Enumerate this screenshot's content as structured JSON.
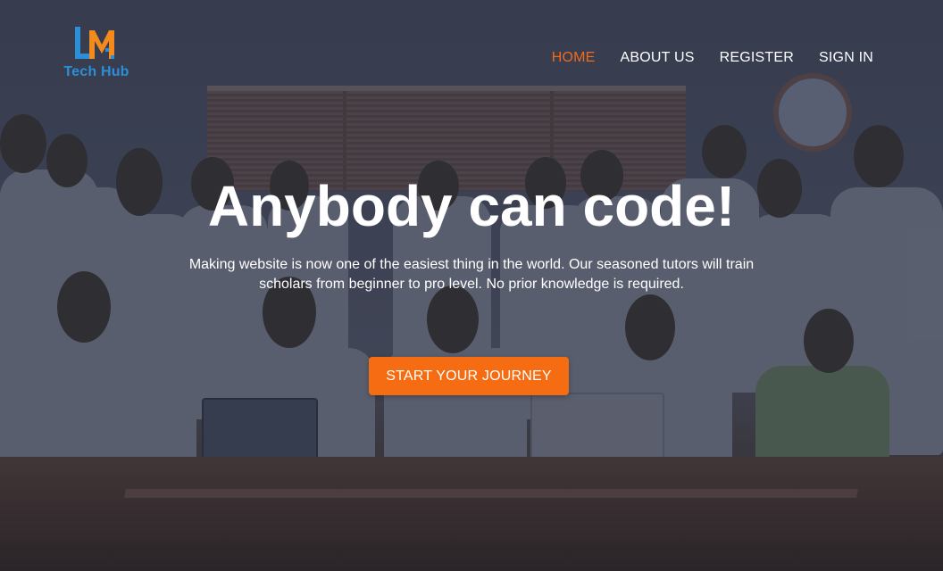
{
  "brand": {
    "logo_text": "Tech Hub",
    "logo_mark": "LM",
    "primary_color": "#2c8fd6",
    "accent_color": "#f26b1d"
  },
  "nav": {
    "items": [
      {
        "label": "HOME",
        "active": true
      },
      {
        "label": "ABOUT US",
        "active": false
      },
      {
        "label": "REGISTER",
        "active": false
      },
      {
        "label": "SIGN IN",
        "active": false
      }
    ]
  },
  "hero": {
    "headline": "Anybody can code!",
    "subtext": "Making website is now one of the easiest thing in the world. Our seasoned tutors will train scholars from beginner to pro level. No prior knowledge is required.",
    "cta_label": "START YOUR JOURNEY",
    "background_image": "group-photo-of-students-and-tutors"
  }
}
